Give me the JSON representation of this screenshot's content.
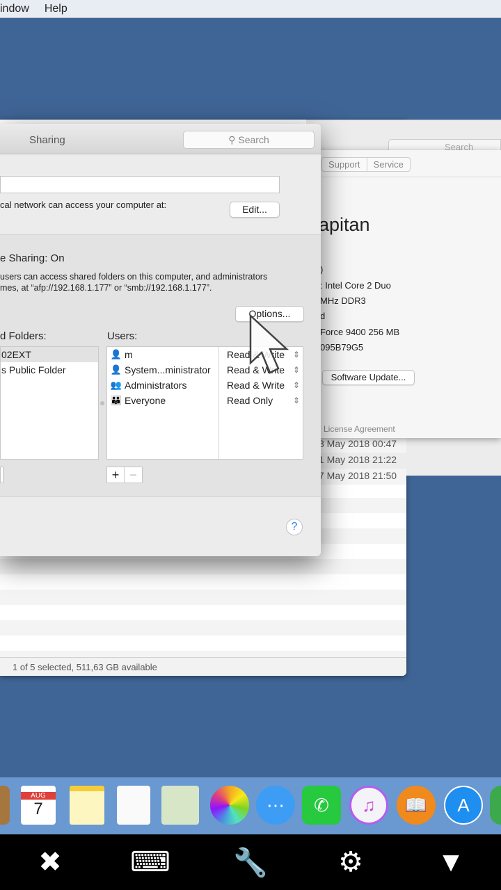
{
  "menubar": {
    "items": [
      "indow",
      "Help"
    ]
  },
  "finder": {
    "status": "1 of 5 selected, 511,63 GB available",
    "dates": [
      "8 May 2018 00:47",
      "1 May 2018 21:22",
      "7 May 2018 21:50"
    ]
  },
  "bg_search": "Search",
  "about": {
    "tabs": [
      "Support",
      "Service"
    ],
    "title": "apitan",
    "lines": [
      ")",
      ": Intel Core 2 Duo",
      "MHz DDR3",
      "d",
      "Force 9400 256 MB",
      "095B79G5"
    ],
    "software_update": "Software Update...",
    "license": "License Agreement"
  },
  "sharing": {
    "title": "Sharing",
    "search_placeholder": "Search",
    "computer_name": "",
    "access_text": "cal network can access your computer at:",
    "edit": "Edit...",
    "status": "e Sharing: On",
    "desc1": "users can access shared folders on this computer, and administrators",
    "desc2": "mes, at “afp://192.168.1.177” or “smb://192.168.1.177”.",
    "options": "Options...",
    "folders_label": "d Folders:",
    "users_label": "Users:",
    "folders": [
      "02EXT",
      "s Public Folder"
    ],
    "users": [
      {
        "name": "m",
        "icon": "user-icon",
        "perm": "Read & Write"
      },
      {
        "name": "System...ministrator",
        "icon": "user-icon",
        "perm": "Read & Write"
      },
      {
        "name": "Administrators",
        "icon": "group-icon",
        "perm": "Read & Write"
      },
      {
        "name": "Everyone",
        "icon": "everyone-icon",
        "perm": "Read Only"
      }
    ],
    "add": "+",
    "remove": "−",
    "help": "?"
  },
  "dock": {
    "items": [
      "contacts",
      "calendar",
      "notes",
      "reminders",
      "maps",
      "photos",
      "messages",
      "facetime",
      "itunes",
      "ibooks",
      "app-store",
      "chrome"
    ],
    "calendar_month": "AUG",
    "calendar_day": "7"
  },
  "bottombar": {
    "items": [
      "close-icon",
      "keyboard-icon",
      "wrench-icon",
      "gear-icon",
      "dropdown-icon"
    ]
  },
  "colors": {
    "desktop": "#3f6596",
    "dock": "#6a98d0",
    "accent": "#2a7ef5"
  }
}
